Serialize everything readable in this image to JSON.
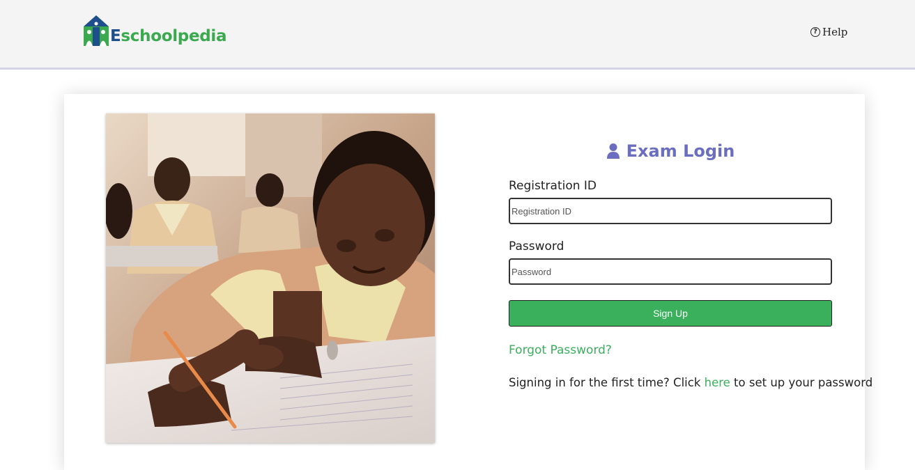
{
  "header": {
    "logo_first_letter": "E",
    "logo_rest": "schoolpedia",
    "help_label": "Help"
  },
  "login": {
    "title": "Exam Login",
    "registration_label": "Registration ID",
    "registration_placeholder": "Registration ID",
    "registration_value": "",
    "password_label": "Password",
    "password_placeholder": "Password",
    "password_value": "",
    "signup_label": "Sign Up",
    "forgot_label": "Forgot Password?",
    "first_time_prefix": "Signing in for the first time? Click ",
    "first_time_link": "here",
    "first_time_suffix": " to set up your password"
  },
  "colors": {
    "accent_green": "#3aaf5c",
    "title_purple": "#6b6ec0",
    "logo_blue": "#1e4f8c"
  }
}
